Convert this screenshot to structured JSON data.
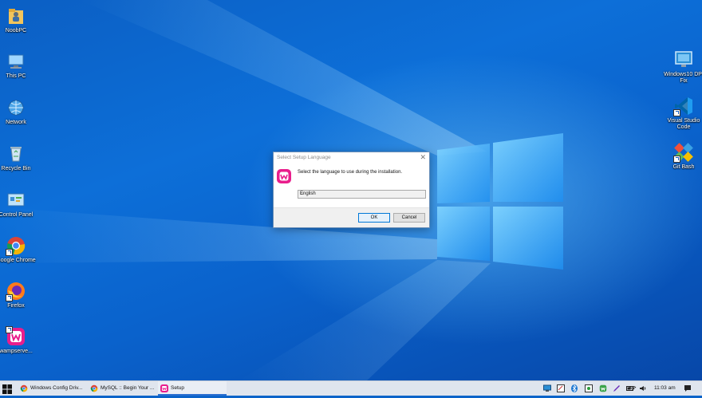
{
  "desktop": {
    "left_icons": [
      {
        "label": "NoobPC",
        "icon": "user-folder-icon"
      },
      {
        "label": "This PC",
        "icon": "computer-icon"
      },
      {
        "label": "Network",
        "icon": "network-icon"
      },
      {
        "label": "Recycle Bin",
        "icon": "recycle-bin-icon"
      },
      {
        "label": "Control Panel",
        "icon": "control-panel-icon"
      },
      {
        "label": "Google Chrome",
        "icon": "chrome-icon"
      },
      {
        "label": "Firefox",
        "icon": "firefox-icon"
      },
      {
        "label": "wampserve...",
        "icon": "wampserver-icon"
      }
    ],
    "right_icons": [
      {
        "label": "Windows10 DPI Fix",
        "icon": "monitor-icon"
      },
      {
        "label": "Visual Studio Code",
        "icon": "vscode-icon"
      },
      {
        "label": "Git Bash",
        "icon": "git-bash-icon"
      }
    ]
  },
  "dialog": {
    "title": "Select Setup Language",
    "close_glyph": "✕",
    "message": "Select the language to use during the installation.",
    "language_selected": "English",
    "ok_label": "OK",
    "cancel_label": "Cancel"
  },
  "taskbar": {
    "items": [
      {
        "label": "Windows Config Driv...",
        "icon": "chrome-icon"
      },
      {
        "label": "MySQL :: Begin Your ...",
        "icon": "chrome-icon"
      },
      {
        "label": "Setup",
        "icon": "wampserver-icon"
      }
    ],
    "clock": "11:03 am"
  },
  "colors": {
    "accent": "#0078d7",
    "wamp_pink": "#e91e8c",
    "desktop_blue": "#0a63c9"
  }
}
